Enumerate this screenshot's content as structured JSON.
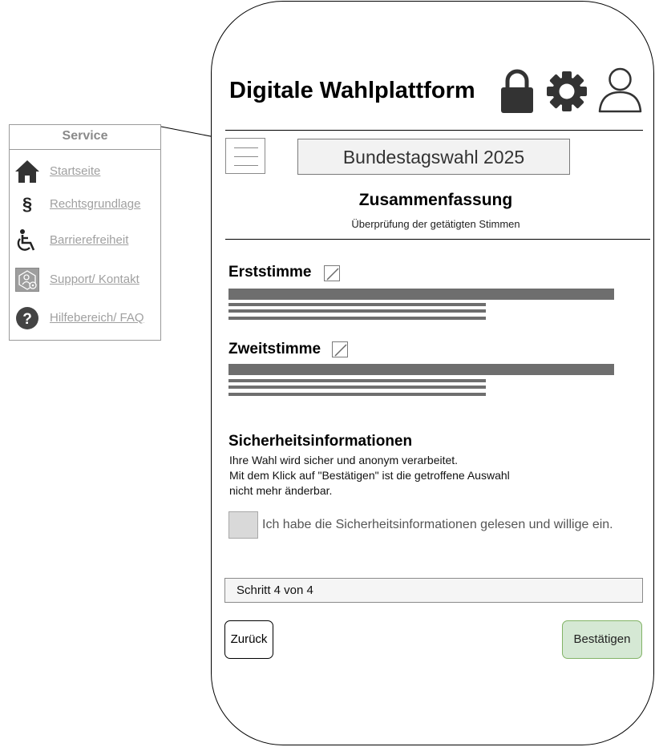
{
  "service": {
    "title": "Service",
    "items": [
      {
        "label": "Startseite",
        "icon": "home-icon"
      },
      {
        "label": "Rechtsgrundlage",
        "icon": "paragraph-icon"
      },
      {
        "label": "Barrierefreiheit",
        "icon": "wheelchair-icon"
      },
      {
        "label": "Support/ Kontakt",
        "icon": "support-icon"
      },
      {
        "label": "Hilfebereich/ FAQ",
        "icon": "question-icon"
      }
    ]
  },
  "header": {
    "title": "Digitale Wahlplattform",
    "icons": [
      "lock-icon",
      "gear-icon",
      "user-icon"
    ]
  },
  "election": {
    "button_label": "Bundestagswahl 2025"
  },
  "summary": {
    "title": "Zusammenfassung",
    "subtitle": "Überprüfung der getätigten Stimmen"
  },
  "votes": [
    {
      "title": "Erststimme"
    },
    {
      "title": "Zweitstimme"
    }
  ],
  "security": {
    "title": "Sicherheitsinformationen",
    "lines": [
      "Ihre Wahl wird sicher und anonym verarbeitet.",
      "Mit dem Klick auf \"Bestätigen\" ist die getroffene Auswahl",
      "nicht mehr änderbar."
    ],
    "consent_label": "Ich habe die Sicherheitsinformationen gelesen und willige ein."
  },
  "progress": {
    "label": "Schritt 4 von 4",
    "current_step": 4,
    "total_steps": 4
  },
  "actions": {
    "back_label": "Zurück",
    "confirm_label": "Bestätigen"
  },
  "colors": {
    "confirm_fill": "#d5e8d4",
    "confirm_border": "#82b366",
    "placeholder_bar": "#6e6e6e",
    "icon_dark": "#333333"
  }
}
